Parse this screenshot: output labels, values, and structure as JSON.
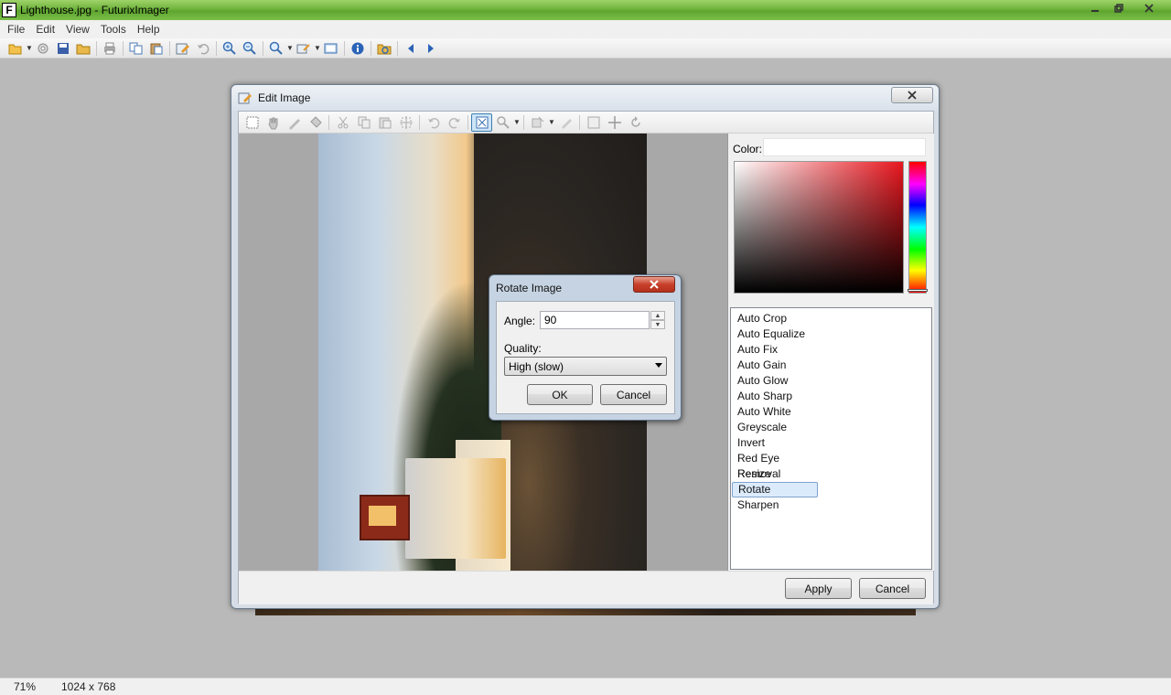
{
  "window": {
    "title": "Lighthouse.jpg - FuturixImager",
    "app_icon_letter": "F"
  },
  "menu": [
    "File",
    "Edit",
    "View",
    "Tools",
    "Help"
  ],
  "toolbar_icons": [
    "open-icon",
    "settings-icon",
    "save-icon",
    "folder-icon",
    "print-icon",
    "copy-icon",
    "paste-icon",
    "edit-icon",
    "undo-icon",
    "zoom-in-icon",
    "zoom-out-icon",
    "zoom-icon",
    "effects-icon",
    "fullscreen-icon",
    "info-icon",
    "browse-icon",
    "prev-icon",
    "next-icon"
  ],
  "edit_dialog": {
    "title": "Edit Image",
    "color_label": "Color:",
    "effects": [
      "Auto Crop",
      "Auto Equalize",
      "Auto Fix",
      "Auto Gain",
      "Auto Glow",
      "Auto Sharp",
      "Auto White",
      "Greyscale",
      "Invert",
      "Red Eye Removal",
      "Resize",
      "Rotate",
      "Sharpen"
    ],
    "selected_effect": "Rotate",
    "apply_label": "Apply",
    "cancel_label": "Cancel"
  },
  "rotate_dialog": {
    "title": "Rotate Image",
    "angle_label": "Angle:",
    "angle_value": "90",
    "quality_label": "Quality:",
    "quality_value": "High (slow)",
    "ok_label": "OK",
    "cancel_label": "Cancel"
  },
  "status": {
    "zoom": "71%",
    "dimensions": "1024 x 768"
  },
  "colors": {
    "title_bar": "#6fb33c",
    "selection": "#dcebfc",
    "accent": "#3c7fb1"
  }
}
